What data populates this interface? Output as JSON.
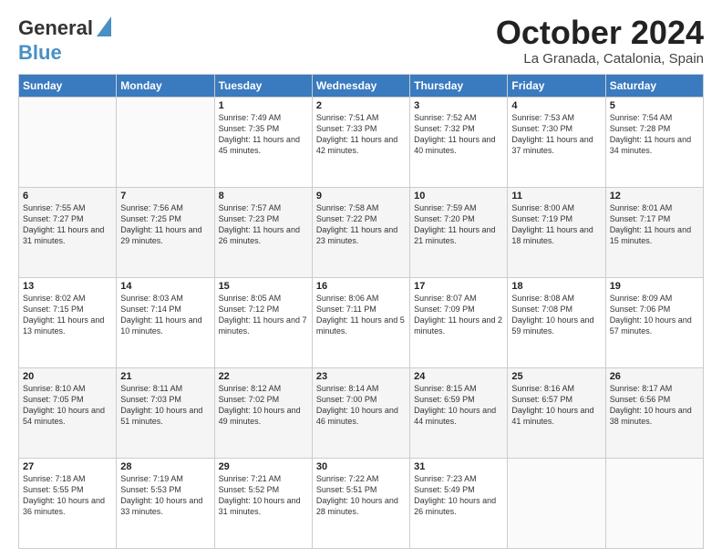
{
  "header": {
    "logo_line1": "General",
    "logo_line2": "Blue",
    "month": "October 2024",
    "location": "La Granada, Catalonia, Spain"
  },
  "columns": [
    "Sunday",
    "Monday",
    "Tuesday",
    "Wednesday",
    "Thursday",
    "Friday",
    "Saturday"
  ],
  "weeks": [
    [
      {
        "day": "",
        "info": ""
      },
      {
        "day": "",
        "info": ""
      },
      {
        "day": "1",
        "info": "Sunrise: 7:49 AM\nSunset: 7:35 PM\nDaylight: 11 hours and 45 minutes."
      },
      {
        "day": "2",
        "info": "Sunrise: 7:51 AM\nSunset: 7:33 PM\nDaylight: 11 hours and 42 minutes."
      },
      {
        "day": "3",
        "info": "Sunrise: 7:52 AM\nSunset: 7:32 PM\nDaylight: 11 hours and 40 minutes."
      },
      {
        "day": "4",
        "info": "Sunrise: 7:53 AM\nSunset: 7:30 PM\nDaylight: 11 hours and 37 minutes."
      },
      {
        "day": "5",
        "info": "Sunrise: 7:54 AM\nSunset: 7:28 PM\nDaylight: 11 hours and 34 minutes."
      }
    ],
    [
      {
        "day": "6",
        "info": "Sunrise: 7:55 AM\nSunset: 7:27 PM\nDaylight: 11 hours and 31 minutes."
      },
      {
        "day": "7",
        "info": "Sunrise: 7:56 AM\nSunset: 7:25 PM\nDaylight: 11 hours and 29 minutes."
      },
      {
        "day": "8",
        "info": "Sunrise: 7:57 AM\nSunset: 7:23 PM\nDaylight: 11 hours and 26 minutes."
      },
      {
        "day": "9",
        "info": "Sunrise: 7:58 AM\nSunset: 7:22 PM\nDaylight: 11 hours and 23 minutes."
      },
      {
        "day": "10",
        "info": "Sunrise: 7:59 AM\nSunset: 7:20 PM\nDaylight: 11 hours and 21 minutes."
      },
      {
        "day": "11",
        "info": "Sunrise: 8:00 AM\nSunset: 7:19 PM\nDaylight: 11 hours and 18 minutes."
      },
      {
        "day": "12",
        "info": "Sunrise: 8:01 AM\nSunset: 7:17 PM\nDaylight: 11 hours and 15 minutes."
      }
    ],
    [
      {
        "day": "13",
        "info": "Sunrise: 8:02 AM\nSunset: 7:15 PM\nDaylight: 11 hours and 13 minutes."
      },
      {
        "day": "14",
        "info": "Sunrise: 8:03 AM\nSunset: 7:14 PM\nDaylight: 11 hours and 10 minutes."
      },
      {
        "day": "15",
        "info": "Sunrise: 8:05 AM\nSunset: 7:12 PM\nDaylight: 11 hours and 7 minutes."
      },
      {
        "day": "16",
        "info": "Sunrise: 8:06 AM\nSunset: 7:11 PM\nDaylight: 11 hours and 5 minutes."
      },
      {
        "day": "17",
        "info": "Sunrise: 8:07 AM\nSunset: 7:09 PM\nDaylight: 11 hours and 2 minutes."
      },
      {
        "day": "18",
        "info": "Sunrise: 8:08 AM\nSunset: 7:08 PM\nDaylight: 10 hours and 59 minutes."
      },
      {
        "day": "19",
        "info": "Sunrise: 8:09 AM\nSunset: 7:06 PM\nDaylight: 10 hours and 57 minutes."
      }
    ],
    [
      {
        "day": "20",
        "info": "Sunrise: 8:10 AM\nSunset: 7:05 PM\nDaylight: 10 hours and 54 minutes."
      },
      {
        "day": "21",
        "info": "Sunrise: 8:11 AM\nSunset: 7:03 PM\nDaylight: 10 hours and 51 minutes."
      },
      {
        "day": "22",
        "info": "Sunrise: 8:12 AM\nSunset: 7:02 PM\nDaylight: 10 hours and 49 minutes."
      },
      {
        "day": "23",
        "info": "Sunrise: 8:14 AM\nSunset: 7:00 PM\nDaylight: 10 hours and 46 minutes."
      },
      {
        "day": "24",
        "info": "Sunrise: 8:15 AM\nSunset: 6:59 PM\nDaylight: 10 hours and 44 minutes."
      },
      {
        "day": "25",
        "info": "Sunrise: 8:16 AM\nSunset: 6:57 PM\nDaylight: 10 hours and 41 minutes."
      },
      {
        "day": "26",
        "info": "Sunrise: 8:17 AM\nSunset: 6:56 PM\nDaylight: 10 hours and 38 minutes."
      }
    ],
    [
      {
        "day": "27",
        "info": "Sunrise: 7:18 AM\nSunset: 5:55 PM\nDaylight: 10 hours and 36 minutes."
      },
      {
        "day": "28",
        "info": "Sunrise: 7:19 AM\nSunset: 5:53 PM\nDaylight: 10 hours and 33 minutes."
      },
      {
        "day": "29",
        "info": "Sunrise: 7:21 AM\nSunset: 5:52 PM\nDaylight: 10 hours and 31 minutes."
      },
      {
        "day": "30",
        "info": "Sunrise: 7:22 AM\nSunset: 5:51 PM\nDaylight: 10 hours and 28 minutes."
      },
      {
        "day": "31",
        "info": "Sunrise: 7:23 AM\nSunset: 5:49 PM\nDaylight: 10 hours and 26 minutes."
      },
      {
        "day": "",
        "info": ""
      },
      {
        "day": "",
        "info": ""
      }
    ]
  ]
}
